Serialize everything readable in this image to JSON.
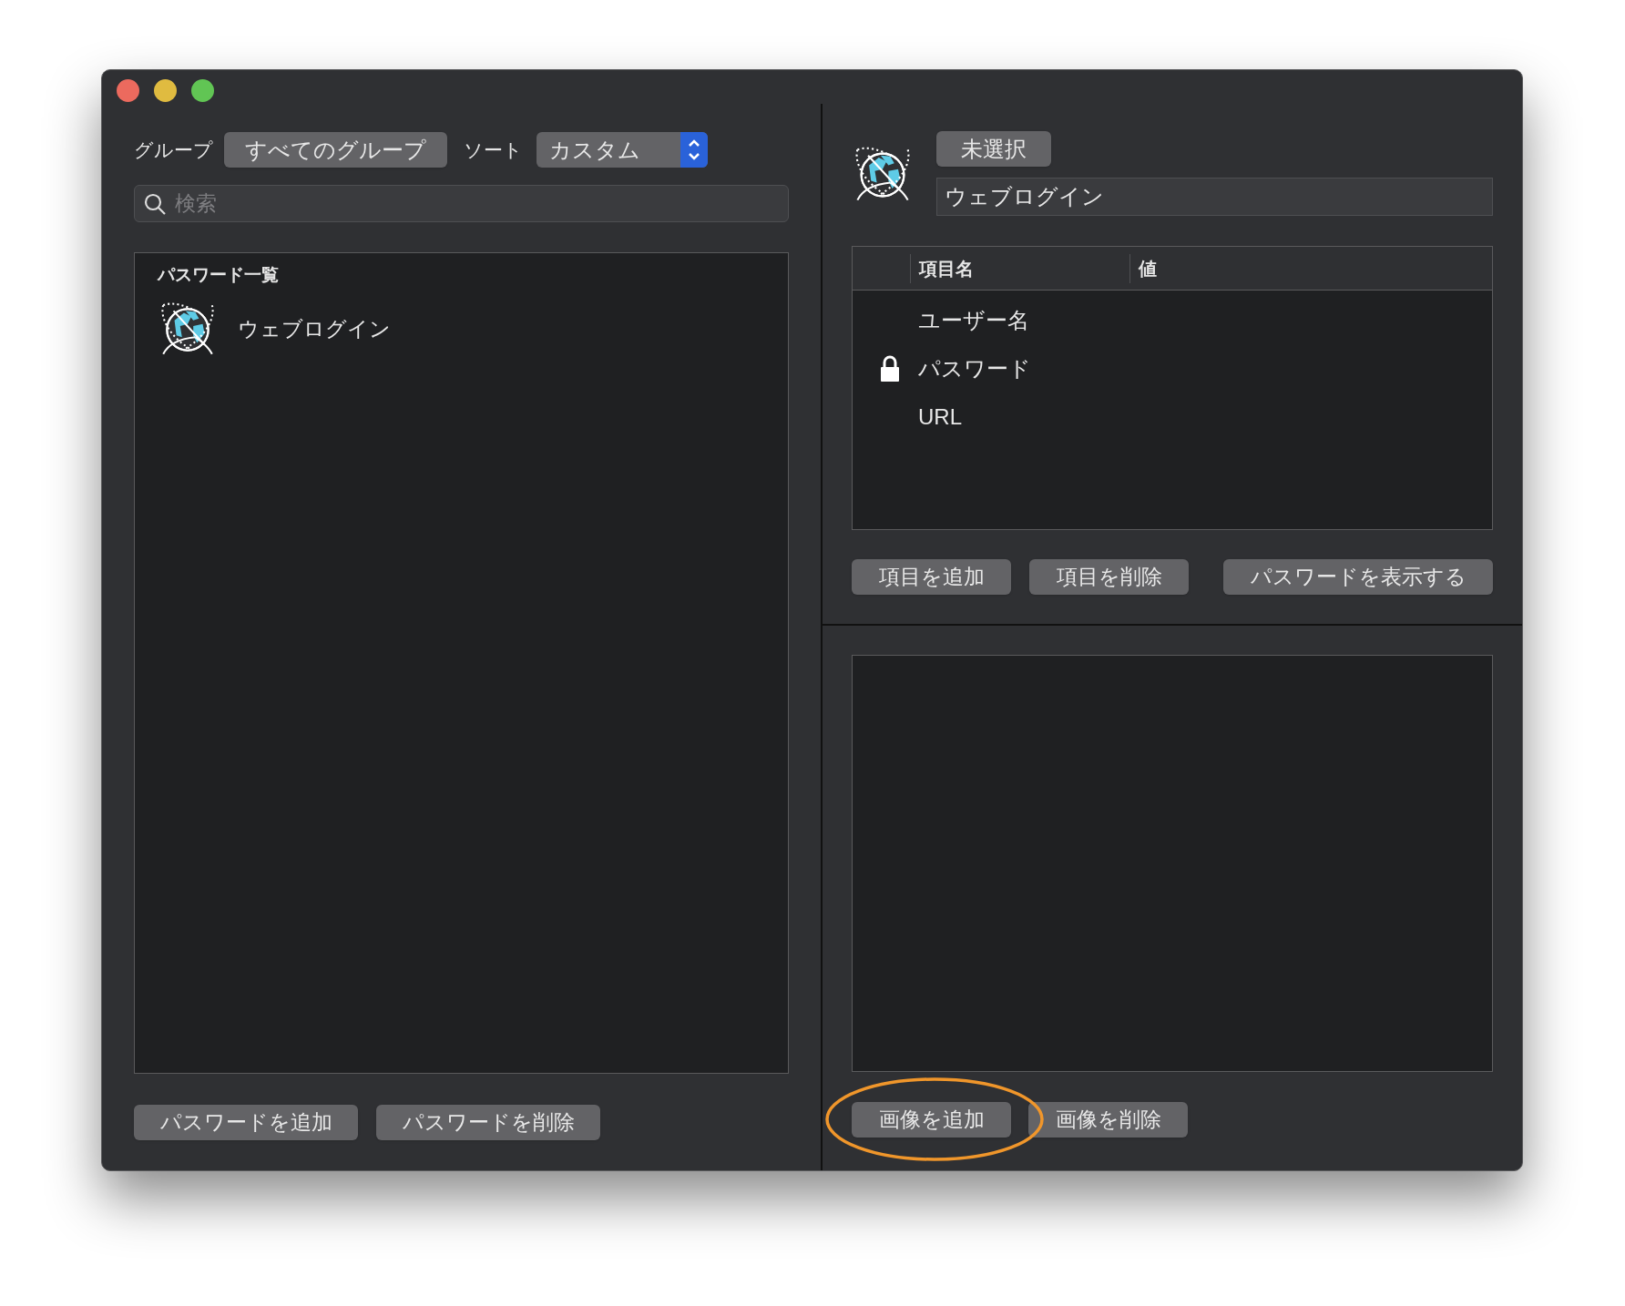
{
  "window": {
    "traffic_lights": [
      {
        "color": "#ec6a5e"
      },
      {
        "color": "#e0bb40"
      },
      {
        "color": "#61c554"
      }
    ]
  },
  "left": {
    "group_label": "グループ",
    "group_button": "すべてのグループ",
    "sort_label": "ソート",
    "sort_select": "カスタム",
    "search": {
      "placeholder": "検索"
    },
    "list": {
      "header": "パスワード一覧",
      "items": [
        {
          "label": "ウェブログイン",
          "selected": false
        }
      ]
    },
    "buttons": [
      "パスワードを追加",
      "パスワードを削除"
    ]
  },
  "right": {
    "category_button": "未選択",
    "name_field": "ウェブログイン",
    "table": {
      "columns": [
        "項目名",
        "値"
      ],
      "rows": [
        {
          "name": "ユーザー名",
          "locked": false
        },
        {
          "name": "パスワード",
          "locked": true
        },
        {
          "name": "URL",
          "locked": false
        }
      ]
    },
    "buttons": [
      "項目を追加",
      "項目を削除",
      "パスワードを表示する"
    ],
    "image_buttons": [
      {
        "label": "画像を追加",
        "highlighted": true
      },
      {
        "label": "画像を削除",
        "highlighted": false
      }
    ]
  }
}
